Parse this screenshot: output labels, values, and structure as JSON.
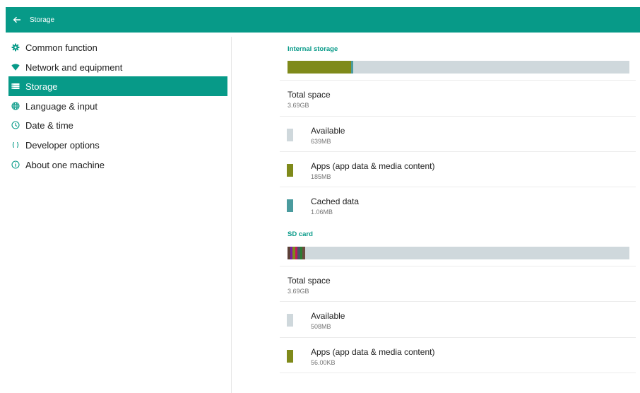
{
  "header": {
    "title": "Storage"
  },
  "sidebar": {
    "items": [
      {
        "label": "Common function",
        "icon": "gear-icon"
      },
      {
        "label": "Network and equipment",
        "icon": "wifi-icon"
      },
      {
        "label": "Storage",
        "icon": "storage-icon",
        "active": true
      },
      {
        "label": "Language & input",
        "icon": "globe-icon"
      },
      {
        "label": "Date & time",
        "icon": "clock-icon"
      },
      {
        "label": "Developer options",
        "icon": "braces-icon"
      },
      {
        "label": "About one machine",
        "icon": "info-icon"
      }
    ]
  },
  "internal": {
    "title": "Internal storage",
    "usage": [
      {
        "fraction": 0.186,
        "color": "#7f8a1a"
      },
      {
        "fraction": 0.006,
        "color": "#4a9b9e"
      }
    ],
    "total": {
      "label": "Total space",
      "value": "3.69GB"
    },
    "available": {
      "label": "Available",
      "value": "639MB",
      "color": "#cfd8dc"
    },
    "apps": {
      "label": "Apps (app data & media content)",
      "value": "185MB",
      "color": "#7f8a1a"
    },
    "cached": {
      "label": "Cached data",
      "value": "1.06MB",
      "color": "#4a9b9e"
    }
  },
  "sdcard": {
    "title": "SD card",
    "usage": [
      {
        "fraction": 0.008,
        "color": "#5d4037"
      },
      {
        "fraction": 0.006,
        "color": "#7b1fa2"
      },
      {
        "fraction": 0.008,
        "color": "#7f8a1a"
      },
      {
        "fraction": 0.006,
        "color": "#c2185b"
      },
      {
        "fraction": 0.008,
        "color": "#455a64"
      },
      {
        "fraction": 0.006,
        "color": "#2e7d32"
      },
      {
        "fraction": 0.008,
        "color": "#6d4c41"
      }
    ],
    "total": {
      "label": "Total space",
      "value": "3.69GB"
    },
    "available": {
      "label": "Available",
      "value": "508MB",
      "color": "#cfd8dc"
    },
    "apps": {
      "label": "Apps (app data & media content)",
      "value": "56.00KB",
      "color": "#7f8a1a"
    }
  }
}
